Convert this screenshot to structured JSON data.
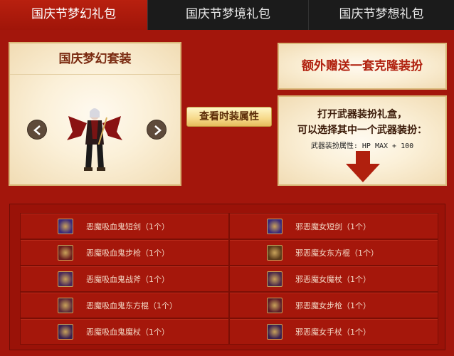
{
  "tabs": [
    {
      "label": "国庆节梦幻礼包",
      "active": true
    },
    {
      "label": "国庆节梦境礼包",
      "active": false
    },
    {
      "label": "国庆节梦想礼包",
      "active": false
    }
  ],
  "suit": {
    "title": "国庆梦幻套装",
    "prev_icon": "chevron-left-icon",
    "next_icon": "chevron-right-icon"
  },
  "view_button_label": "查看时装属性",
  "bonus": {
    "text": "额外赠送一套克隆装扮"
  },
  "weapon_box": {
    "line1": "打开武器装扮礼盒，",
    "line2": "可以选择其中一个武器装扮：",
    "attr": "武器装扮属性: HP MAX + 100",
    "arrow_icon": "down-arrow-icon"
  },
  "items_left": [
    {
      "name": "恶魔吸血鬼短剑（1个）",
      "icon_color": "#3a2a7a"
    },
    {
      "name": "恶魔吸血鬼步枪（1个）",
      "icon_color": "#6a1e1e"
    },
    {
      "name": "恶魔吸血鬼战斧（1个）",
      "icon_color": "#4a2a5a"
    },
    {
      "name": "恶魔吸血鬼东方棍（1个）",
      "icon_color": "#5a2a3a"
    },
    {
      "name": "恶魔吸血鬼魔杖（1个）",
      "icon_color": "#3a2050"
    }
  ],
  "items_right": [
    {
      "name": "邪恶魔女短剑（1个）",
      "icon_color": "#3a2a7a"
    },
    {
      "name": "邪恶魔女东方棍（1个）",
      "icon_color": "#5a3a1a"
    },
    {
      "name": "邪恶魔女魔杖（1个）",
      "icon_color": "#4a2a4a"
    },
    {
      "name": "邪恶魔女步枪（1个）",
      "icon_color": "#5a1e2a"
    },
    {
      "name": "邪恶魔女手杖（1个）",
      "icon_color": "#3a2050"
    }
  ],
  "colors": {
    "background": "#a3160c",
    "tab_active": "#b8200f",
    "tab_inactive": "#1b1b1b",
    "panel": "#fbf0d8",
    "accent_text": "#b0200e"
  }
}
